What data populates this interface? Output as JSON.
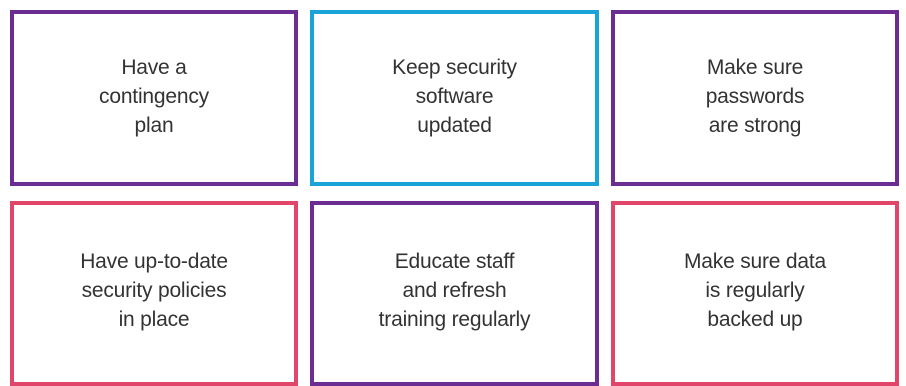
{
  "cards": [
    {
      "text": "Have a\ncontingency\nplan",
      "border_color": "#6B2D91"
    },
    {
      "text": "Keep security\nsoftware\nupdated",
      "border_color": "#19A3D9"
    },
    {
      "text": "Make sure\npasswords\nare strong",
      "border_color": "#6B2D91"
    },
    {
      "text": "Have up-to-date\nsecurity policies\nin place",
      "border_color": "#E2456A"
    },
    {
      "text": "Educate staff\nand refresh\ntraining regularly",
      "border_color": "#6B2D91"
    },
    {
      "text": "Make sure data\nis regularly\nbacked up",
      "border_color": "#E2456A"
    }
  ]
}
